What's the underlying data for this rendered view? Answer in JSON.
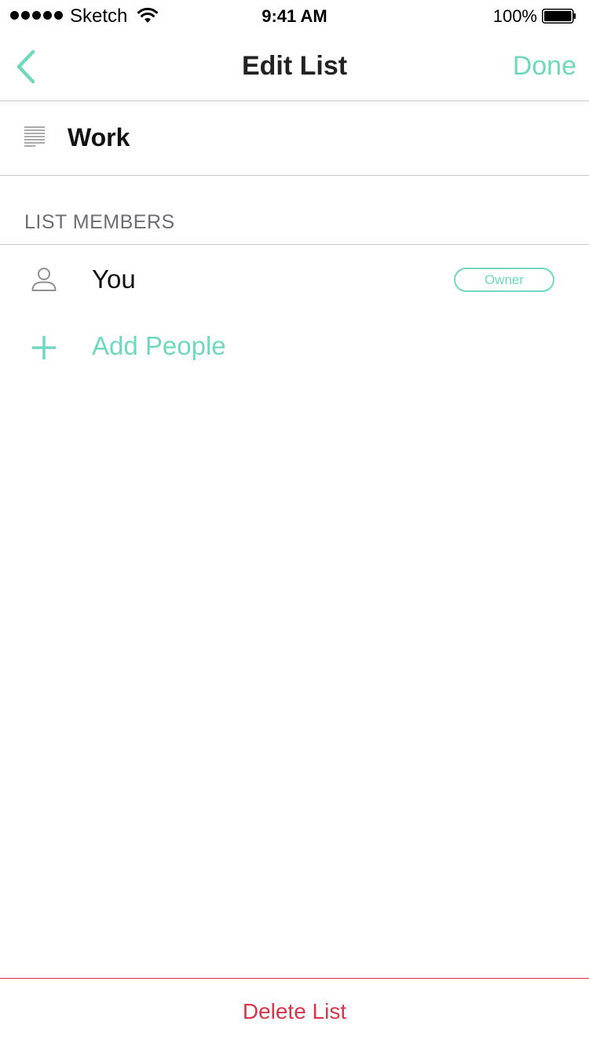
{
  "status_bar": {
    "carrier": "Sketch",
    "time": "9:41 AM",
    "battery_percent": "100%",
    "signal_bars": 5,
    "battery_level": 1.0,
    "icons": [
      "signal-dots-icon",
      "wifi-icon",
      "battery-icon"
    ]
  },
  "nav": {
    "back_icon": "chevron-left-icon",
    "title": "Edit List",
    "done_label": "Done"
  },
  "list": {
    "icon": "text-lines-icon",
    "name": "Work"
  },
  "members_section": {
    "header": "LIST MEMBERS",
    "members": [
      {
        "icon": "person-icon",
        "name": "You",
        "badge": "Owner"
      }
    ],
    "add": {
      "icon": "plus-icon",
      "label": "Add People"
    }
  },
  "footer": {
    "delete_label": "Delete List"
  },
  "colors": {
    "accent": "#6fd8bf",
    "destructive": "#d6364a",
    "separator": "#c8c7cc",
    "section_text": "#6d6d72"
  }
}
